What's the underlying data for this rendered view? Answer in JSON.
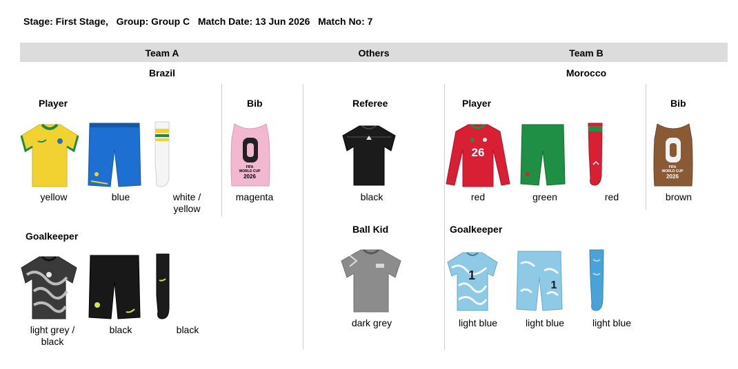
{
  "header": {
    "stage": "Stage: First Stage,",
    "group": "Group: Group C",
    "match_date": "Match Date: 13 Jun 2026",
    "match_no": "Match No: 7"
  },
  "columns": {
    "team_a": "Team A",
    "others": "Others",
    "team_b": "Team B"
  },
  "team_a": {
    "name": "Brazil",
    "player_title": "Player",
    "bib_title": "Bib",
    "goalkeeper_title": "Goalkeeper",
    "player": {
      "shirt": "yellow",
      "shorts": "blue",
      "socks_line1": "white /",
      "socks_line2": "yellow"
    },
    "bib": "magenta",
    "goalkeeper": {
      "shirt_line1": "light grey /",
      "shirt_line2": "black",
      "shorts": "black",
      "socks": "black"
    },
    "shirt_number": "",
    "bib_badge": [
      "FIFA",
      "WORLD CUP",
      "2026"
    ]
  },
  "others": {
    "referee_title": "Referee",
    "referee": "black",
    "ball_kid_title": "Ball Kid",
    "ball_kid": "dark grey"
  },
  "team_b": {
    "name": "Morocco",
    "player_title": "Player",
    "bib_title": "Bib",
    "goalkeeper_title": "Goalkeeper",
    "player": {
      "shirt": "red",
      "shorts": "green",
      "socks": "red",
      "shirt_number": "26"
    },
    "bib": "brown",
    "goalkeeper": {
      "shirt": "light blue",
      "shorts": "light blue",
      "socks": "light blue",
      "shirt_number": "1",
      "shorts_number": "1"
    },
    "bib_badge": [
      "FIFA",
      "WORLD CUP",
      "2026"
    ]
  },
  "colors": {
    "band": "#dcdcdc",
    "brazil_yellow": "#f2d230",
    "brazil_blue": "#1d6fd1",
    "magenta_bib": "#f1b8cf",
    "referee_black": "#1b1b1b",
    "morocco_red": "#d81f34",
    "morocco_green": "#1f8f45",
    "brown_bib": "#8a5a35",
    "gk_light_blue": "#8ec9e6",
    "dark_grey": "#8c8c8c"
  },
  "icons": [
    "shirt-icon",
    "shorts-icon",
    "sock-icon",
    "bib-icon"
  ]
}
